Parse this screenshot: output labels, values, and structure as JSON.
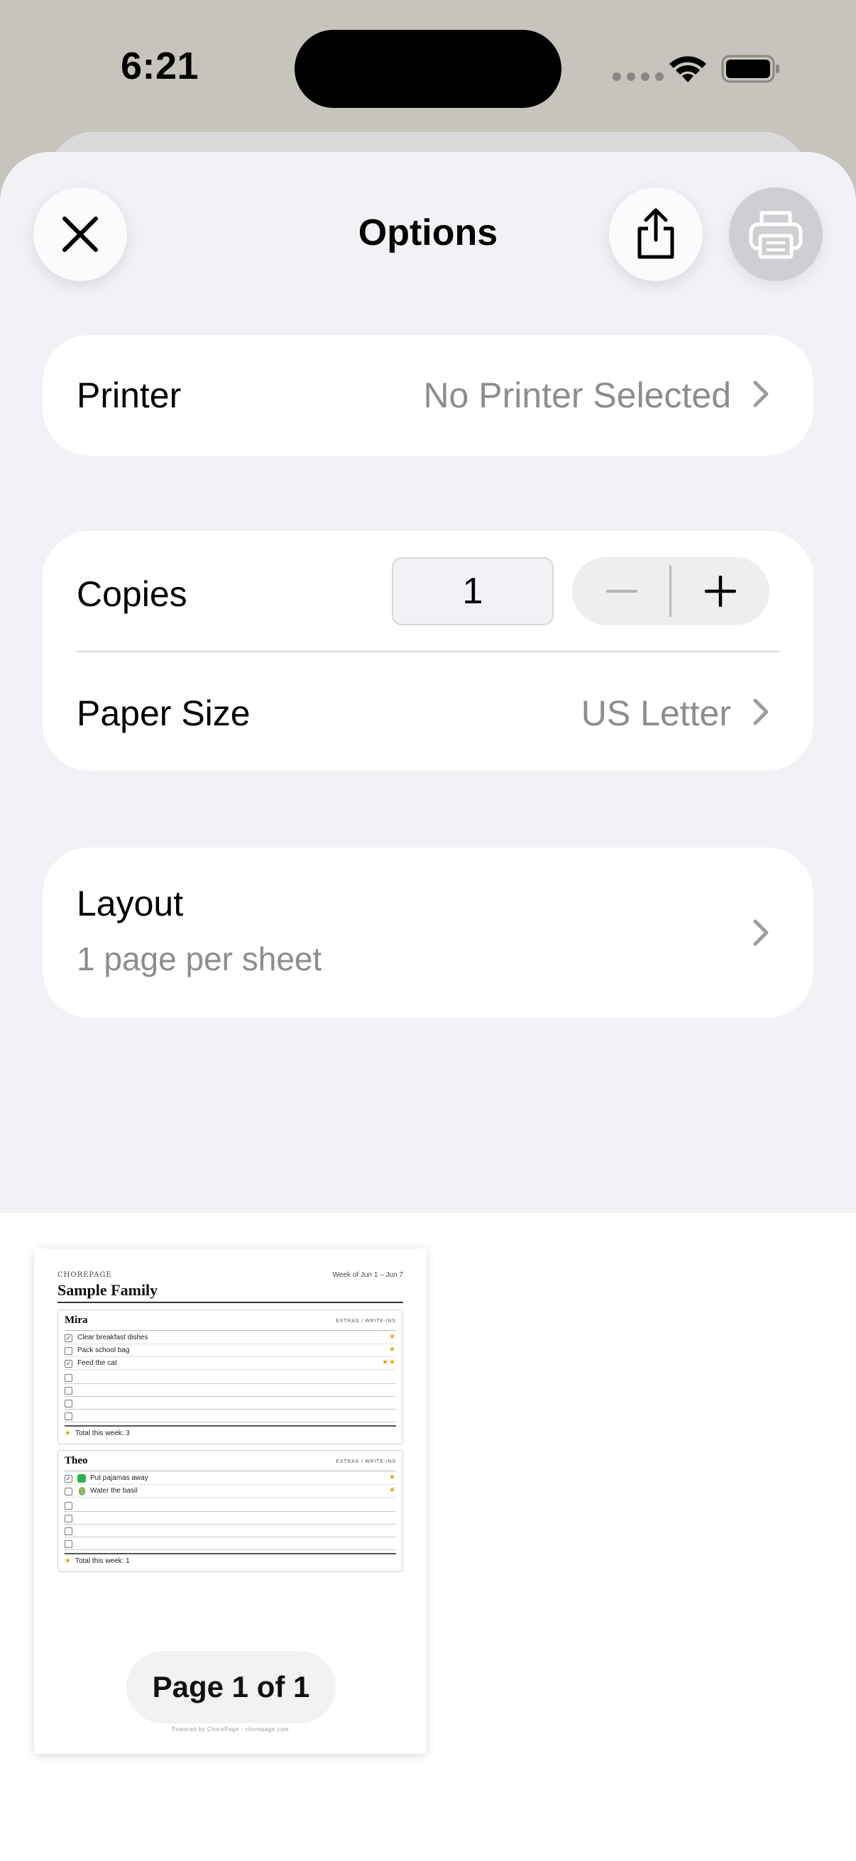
{
  "status_bar": {
    "time": "6:21"
  },
  "sheet": {
    "title": "Options",
    "close_icon": "close-icon",
    "share_icon": "share-icon",
    "print_icon": "printer-icon"
  },
  "printer": {
    "label": "Printer",
    "value": "No Printer Selected"
  },
  "copies": {
    "label": "Copies",
    "value": "1",
    "minus": "−",
    "plus": "+"
  },
  "paper_size": {
    "label": "Paper Size",
    "value": "US Letter"
  },
  "layout": {
    "label": "Layout",
    "value": "1 page per sheet"
  },
  "preview": {
    "brand": "CHOREPAGE",
    "week": "Week of Jun 1 – Jun 7",
    "family": "Sample Family",
    "kids": [
      {
        "name": "Mira",
        "extras": "EXTRAS / WRITE-INS",
        "chores": [
          {
            "label": "Clear breakfast dishes",
            "checked": "✓",
            "stars": "★"
          },
          {
            "label": "Pack school bag",
            "checked": "",
            "stars": "★"
          },
          {
            "label": "Feed the cat",
            "checked": "✓",
            "stars": "★★"
          }
        ],
        "total": "Total this week: 3"
      },
      {
        "name": "Theo",
        "extras": "EXTRAS / WRITE-INS",
        "chores": [
          {
            "label": "Put pajamas away",
            "checked": "✓",
            "stars": "★"
          },
          {
            "label": "Water the basil",
            "checked": "",
            "stars": "★"
          }
        ],
        "total": "Total this week: 1"
      }
    ],
    "footer": "Powered by ChorePage · chorepage.com",
    "page_indicator": "Page 1 of 1"
  },
  "colors": {
    "sheet_bg": "#f1f1f6",
    "secondary_text": "#8c8c91",
    "star": "#e6a100",
    "check_green": "#2cb34a"
  }
}
